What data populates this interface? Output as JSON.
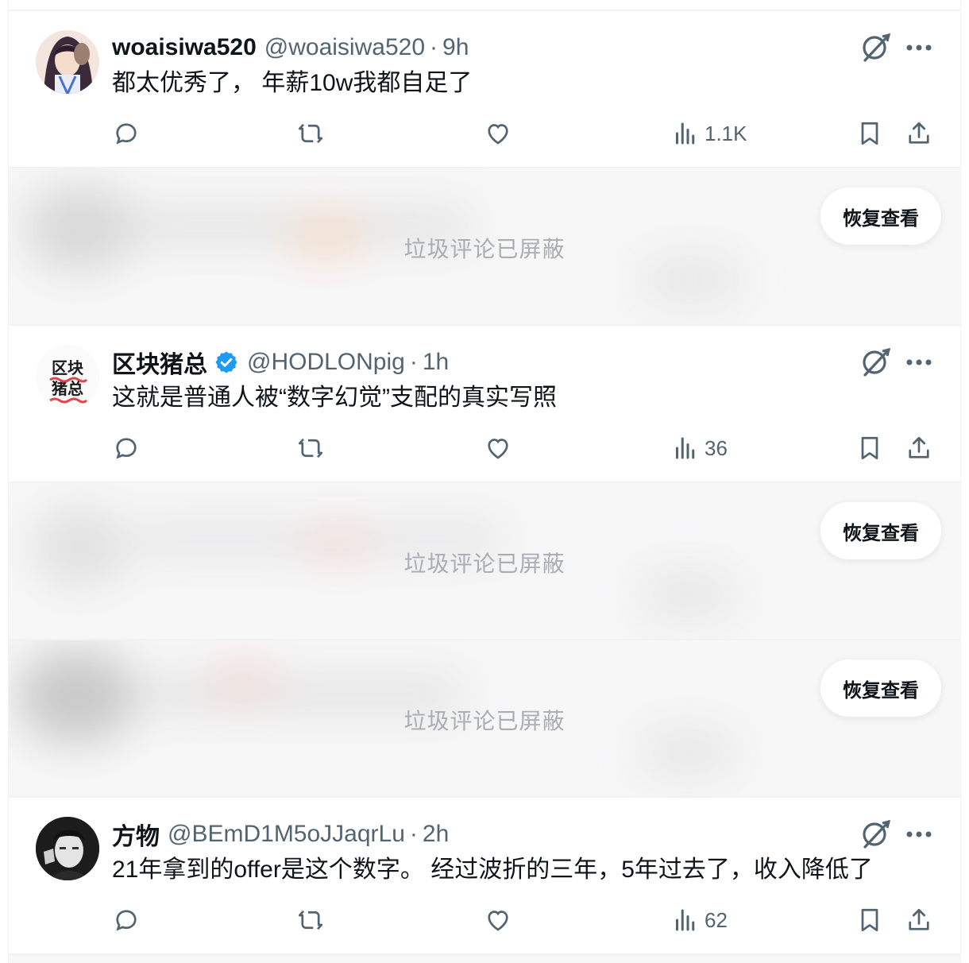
{
  "tweets": [
    {
      "name": "woaisiwa520",
      "handle": "@woaisiwa520",
      "time": "9h",
      "text": "都太优秀了， 年薪10w我都自足了",
      "views": "1.1K"
    },
    {
      "name": "区块猪总",
      "handle": "@HODLONpig",
      "time": "1h",
      "text": "这就是普通人被“数字幻觉”支配的真实写照",
      "views": "36",
      "avatar_text_top": "区块",
      "avatar_text_bottom": "猪总"
    },
    {
      "name": "方物",
      "handle": "@BEmD1M5oJJaqrLu",
      "time": "2h",
      "text": "21年拿到的offer是这个数字。 经过波折的三年，5年过去了，收入降低了",
      "views": "62"
    }
  ],
  "hidden": {
    "label": "垃圾评论已屏蔽",
    "restore": "恢复查看"
  },
  "separator": "·",
  "colors": {
    "verified": "#1d9bf0",
    "secondary_text": "#536471",
    "divider": "#eff3f4"
  },
  "icons": [
    "reply-icon",
    "retweet-icon",
    "like-icon",
    "views-icon",
    "bookmark-icon",
    "share-icon",
    "grok-icon",
    "more-icon",
    "verified-badge-icon"
  ]
}
